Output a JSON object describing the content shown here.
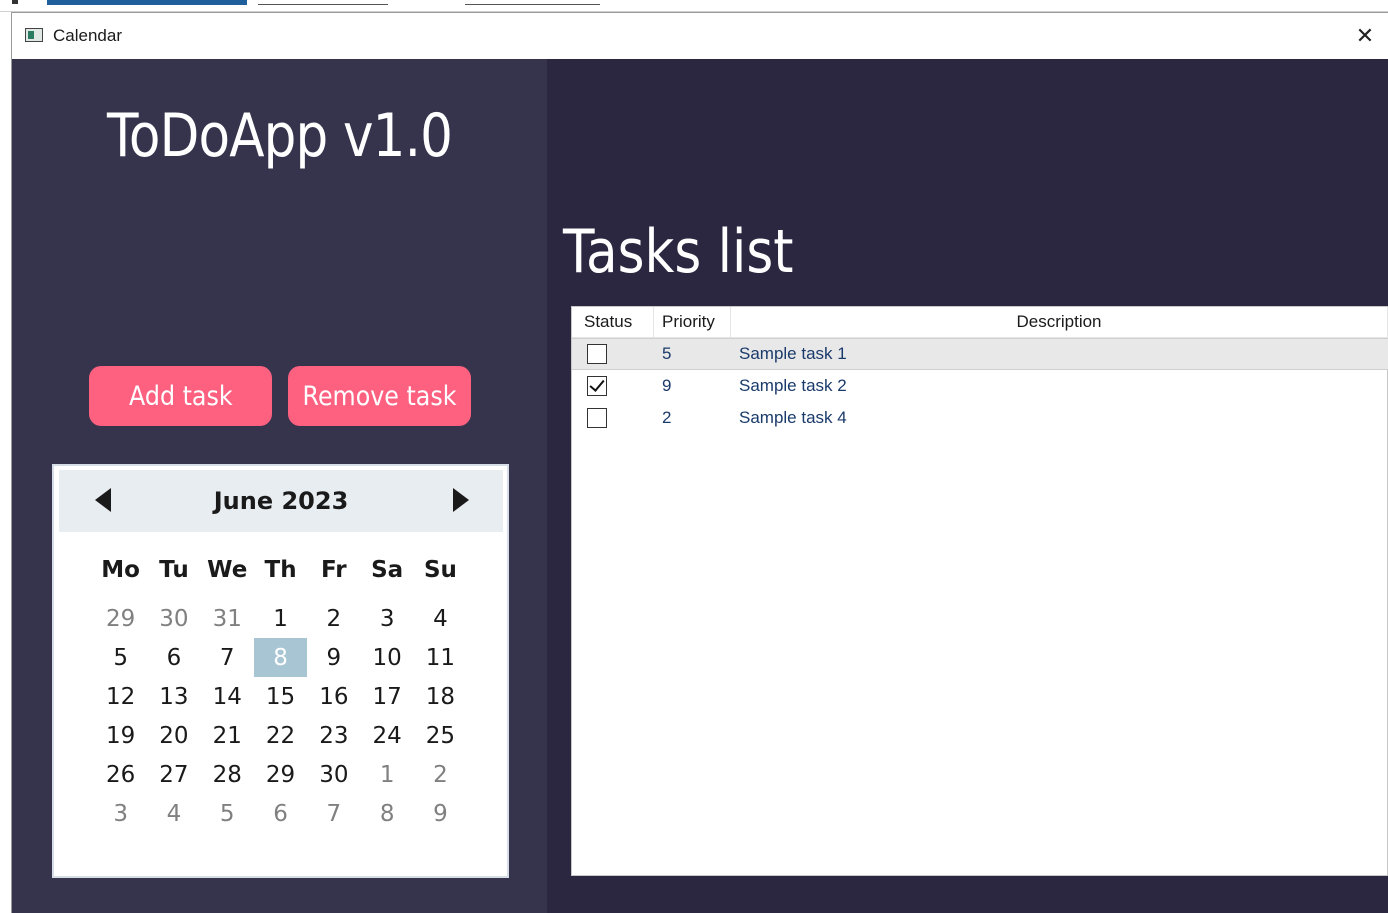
{
  "window": {
    "title": "Calendar"
  },
  "sidebar": {
    "app_title": "ToDoApp v1.0",
    "add_button": "Add task",
    "remove_button": "Remove task"
  },
  "calendar": {
    "month_label": "June 2023",
    "weekdays": [
      "Mo",
      "Tu",
      "We",
      "Th",
      "Fr",
      "Sa",
      "Su"
    ],
    "selected_day": "8",
    "weeks": [
      [
        {
          "d": "29",
          "o": true
        },
        {
          "d": "30",
          "o": true
        },
        {
          "d": "31",
          "o": true
        },
        {
          "d": "1"
        },
        {
          "d": "2"
        },
        {
          "d": "3"
        },
        {
          "d": "4"
        }
      ],
      [
        {
          "d": "5"
        },
        {
          "d": "6"
        },
        {
          "d": "7"
        },
        {
          "d": "8",
          "s": true
        },
        {
          "d": "9"
        },
        {
          "d": "10"
        },
        {
          "d": "11"
        }
      ],
      [
        {
          "d": "12"
        },
        {
          "d": "13"
        },
        {
          "d": "14"
        },
        {
          "d": "15"
        },
        {
          "d": "16"
        },
        {
          "d": "17"
        },
        {
          "d": "18"
        }
      ],
      [
        {
          "d": "19"
        },
        {
          "d": "20"
        },
        {
          "d": "21"
        },
        {
          "d": "22"
        },
        {
          "d": "23"
        },
        {
          "d": "24"
        },
        {
          "d": "25"
        }
      ],
      [
        {
          "d": "26"
        },
        {
          "d": "27"
        },
        {
          "d": "28"
        },
        {
          "d": "29"
        },
        {
          "d": "30"
        },
        {
          "d": "1",
          "o": true
        },
        {
          "d": "2",
          "o": true
        }
      ],
      [
        {
          "d": "3",
          "o": true
        },
        {
          "d": "4",
          "o": true
        },
        {
          "d": "5",
          "o": true
        },
        {
          "d": "6",
          "o": true
        },
        {
          "d": "7",
          "o": true
        },
        {
          "d": "8",
          "o": true
        },
        {
          "d": "9",
          "o": true
        }
      ]
    ]
  },
  "tasks": {
    "title": "Tasks list",
    "columns": {
      "status": "Status",
      "priority": "Priority",
      "description": "Description"
    },
    "rows": [
      {
        "checked": false,
        "priority": "5",
        "description": "Sample task 1",
        "selected": true
      },
      {
        "checked": true,
        "priority": "9",
        "description": "Sample task 2",
        "selected": false
      },
      {
        "checked": false,
        "priority": "2",
        "description": "Sample task 4",
        "selected": false
      }
    ]
  },
  "colors": {
    "sidebar_bg": "#36334d",
    "main_bg": "#2b2740",
    "accent": "#fe6080",
    "calendar_selected": "#a7c5d2"
  },
  "icons": {
    "close": "close-icon",
    "app": "calendar-app-icon",
    "prev": "chevron-left-icon",
    "next": "chevron-right-icon"
  }
}
